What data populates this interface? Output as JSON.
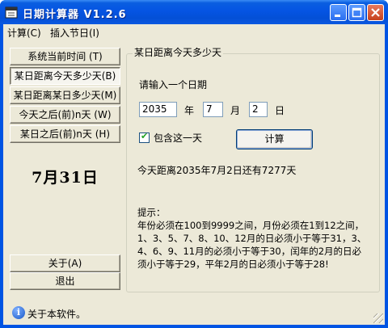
{
  "window": {
    "title": "日期计算器  V1.2.6"
  },
  "menu": {
    "calc": "计算(C)",
    "insert_holiday": "插入节日(I)"
  },
  "left_buttons": {
    "system_time": "系统当前时间   (T)",
    "days_to_today": "某日距离今天多少天(B)",
    "days_between": "某日距离某日多少天(M)",
    "after_today": "今天之后(前)n天  (W)",
    "after_date": "某日之后(前)n天  (H)",
    "about": "关于(A)",
    "exit": "退出"
  },
  "big_date": "7月31日",
  "group": {
    "title": "某日距离今天多少天",
    "prompt": "请输入一个日期",
    "year_value": "2035",
    "year_unit": "年",
    "month_value": "7",
    "month_unit": "月",
    "day_value": "2",
    "day_unit": "日",
    "include_day_label": "包含这一天",
    "include_day_checked": true,
    "calc_button": "计算",
    "result": "今天距离2035年7月2日还有7277天",
    "tip_title": "提示：",
    "tip_lines": [
      "年份必须在100到9999之间，月份必须在1到12之间，",
      "1、3、5、7、8、10、12月的日必须小于等于31，3、",
      "4、6、9、11月的必须小于等于30，闰年的2月的日必",
      "须小于等于29，平年2月的日必须小于等于28!"
    ]
  },
  "status": {
    "text": "关于本软件。"
  },
  "colors": {
    "titlebar": "#0054e3",
    "face": "#ece9d8"
  }
}
